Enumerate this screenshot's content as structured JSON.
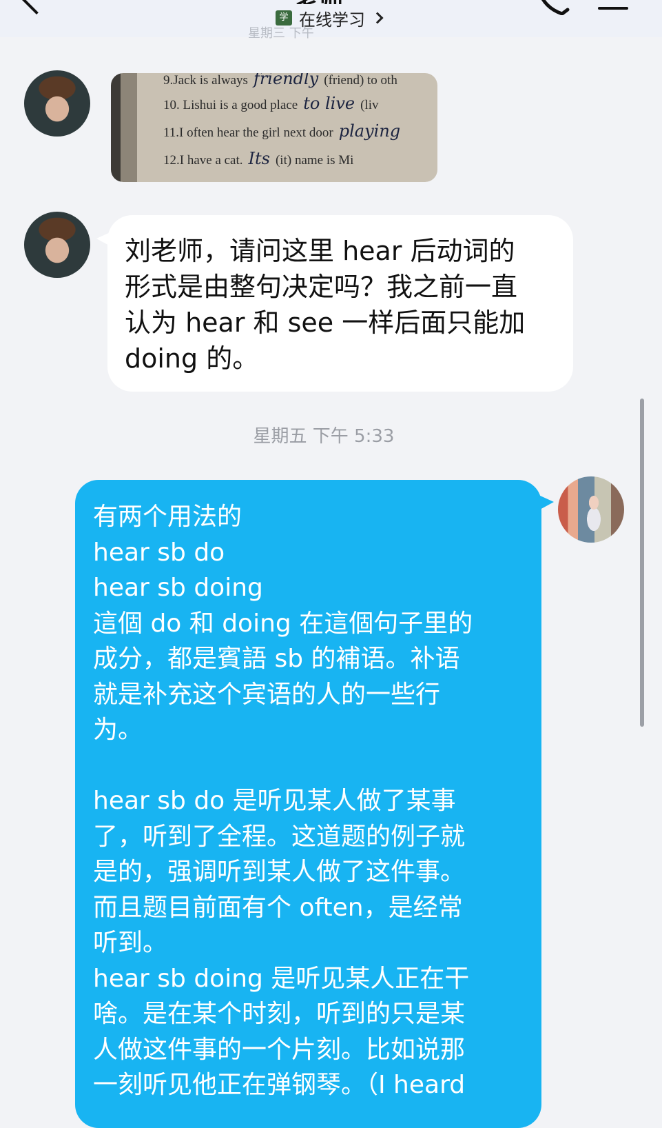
{
  "header": {
    "title": "老师",
    "subtitle": "在线学习",
    "subtitle_icon_text": "学",
    "previous_timestamp": "星期三 下午"
  },
  "photo": {
    "lines": [
      {
        "printed_start": "9.Jack is always",
        "handwritten": "friendly",
        "printed_end": "(friend) to oth"
      },
      {
        "printed_start": "10. Lishui is a good place",
        "handwritten": "to live",
        "printed_end": "(liv"
      },
      {
        "printed_start": "11.I often hear the girl next door",
        "handwritten": "playing",
        "printed_end": ""
      },
      {
        "printed_start": "12.I have a cat.",
        "handwritten": "Its",
        "printed_end": "(it) name is Mi"
      }
    ]
  },
  "messages": [
    {
      "side": "left",
      "text": "刘老师，请问这里 hear 后动词的\n形式是由整句决定吗？我之前一直\n认为 hear 和 see 一样后面只能加\ndoing 的。"
    },
    {
      "timestamp": "星期五 下午 5:33"
    },
    {
      "side": "right",
      "text": "有两个用法的\nhear sb do\nhear sb doing\n這個 do 和 doing 在這個句子里的\n成分，都是賓語 sb 的補语。补语\n就是补充这个宾语的人的一些行\n为。\n\nhear sb do 是听见某人做了某事\n了，听到了全程。这道题的例子就\n是的，强调听到某人做了这件事。\n而且题目前面有个 often，是经常\n听到。\nhear sb doing 是听见某人正在干\n啥。是在某个时刻，听到的只是某\n人做这件事的一个片刻。比如说那\n一刻听见他正在弹钢琴。（I heard"
    }
  ],
  "colors": {
    "background": "#f2f3f6",
    "incoming_bubble": "#ffffff",
    "outgoing_bubble": "#18b4f2",
    "timestamp": "#9a9da4"
  }
}
